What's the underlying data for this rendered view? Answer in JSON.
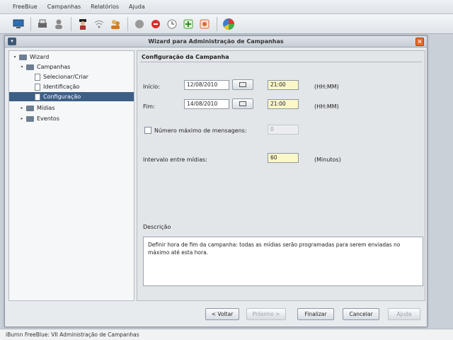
{
  "menu": [
    "FreeBiue",
    "Campanhas",
    "Relatórios",
    "Ajuda"
  ],
  "toolbar": {
    "icons": [
      "monitor-icon",
      "printer-icon",
      "user-gray-icon",
      "spy-icon",
      "wifi-icon",
      "user-group-icon",
      "gray-circle-icon",
      "stop-icon",
      "clock-icon",
      "green-plus-icon",
      "tools-icon",
      "pie-chart-icon"
    ]
  },
  "window": {
    "title": "Wizard para Administração de Campanhas"
  },
  "tree": {
    "root": "Wizard",
    "campanhas": "Campanhas",
    "selecionar": "Selecionar/Criar",
    "identificacao": "Identificação",
    "configuracao": "Configuração",
    "midias": "Mídias",
    "eventos": "Eventos"
  },
  "form": {
    "section_title": "Configuração da Campanha",
    "inicio_label": "Início:",
    "inicio_date": "12/08/2010",
    "inicio_time": "21:00",
    "fim_label": "Fim:",
    "fim_date": "14/08/2010",
    "fim_time": "21:00",
    "hhmm": "(HH:MM)",
    "max_msgs_label": "Número máximo de mensagens:",
    "max_msgs_value": "0",
    "intervalo_label": "Intervalo entre mídias:",
    "intervalo_value": "60",
    "minutos": "(Minutos)",
    "descricao_label": "Descrição",
    "descricao_text": "Definir hora de fim da campanha: todas as mídias serão programadas para serem enviadas no máximo até esta hora."
  },
  "buttons": {
    "voltar": "< Voltar",
    "proximo": "Próximo >",
    "finalizar": "Finalizar",
    "cancelar": "Cancelar",
    "ajuda": "Ajuda"
  },
  "status": {
    "text": "iBurnn FreeBlue: VII   Administração de Campanhas"
  }
}
